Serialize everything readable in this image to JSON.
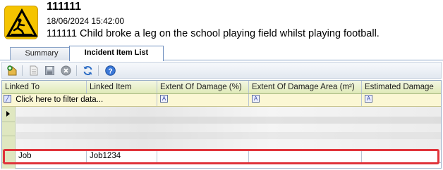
{
  "incident": {
    "title": "111111",
    "datetime": "18/06/2024 15:42:00",
    "description": "111111 Child broke a leg on the school playing field whilst playing football."
  },
  "tabs": [
    {
      "label": "Summary",
      "active": false
    },
    {
      "label": "Incident Item List",
      "active": true
    }
  ],
  "toolbar": {
    "buttons": [
      "add-icon",
      "document-icon",
      "save-icon",
      "delete-icon",
      "refresh-icon",
      "help-icon"
    ]
  },
  "grid": {
    "columns": [
      "Linked To",
      "Linked Item",
      "Extent Of Damage (%)",
      "Extent Of Damage Area (m²)",
      "Estimated Damage"
    ],
    "filter_placeholder": "Click here to filter data...",
    "filter_glyph": "A",
    "rows": [
      {
        "linked_to": "Job",
        "linked_item": "Job1234",
        "extent_pct": "",
        "extent_area": "",
        "estimated": ""
      }
    ]
  },
  "colors": {
    "highlight": "#e0333a",
    "header_bg": "#e8efc8",
    "filter_bg": "#fbf7d4"
  }
}
